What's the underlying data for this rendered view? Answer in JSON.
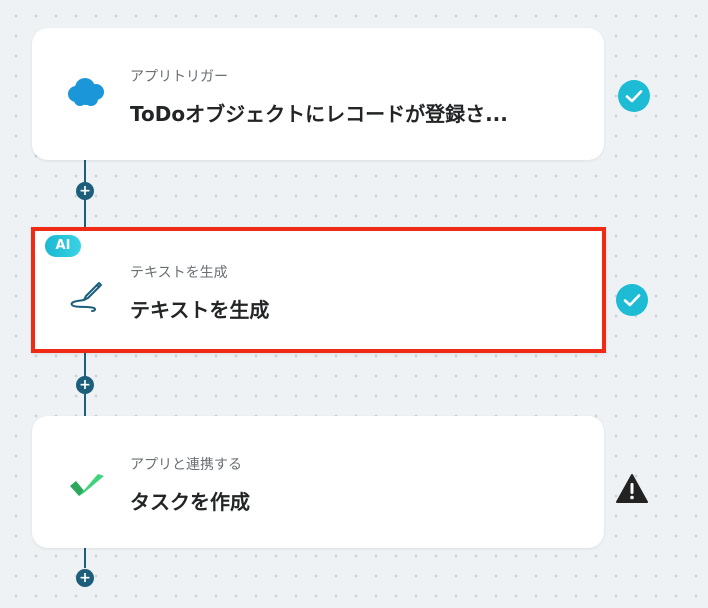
{
  "flow": {
    "steps": [
      {
        "subtitle": "アプリトリガー",
        "title": "ToDoオブジェクトにレコードが登録さ...",
        "icon": "salesforce-cloud-icon",
        "status": "completed"
      },
      {
        "subtitle": "テキストを生成",
        "title": "テキストを生成",
        "icon": "pen-signature-icon",
        "badge": "AI",
        "status": "completed"
      },
      {
        "subtitle": "アプリと連携する",
        "title": "タスクを作成",
        "icon": "green-checkmark-app-icon",
        "status": "warning"
      }
    ],
    "add_step_icon": "+"
  },
  "colors": {
    "accent_teal": "#1ebcd4",
    "connector": "#1d5f7a",
    "selected_border": "#f02b15",
    "warning": "#222222",
    "salesforce_blue": "#1b96d8",
    "app_green": "#27c46b"
  }
}
